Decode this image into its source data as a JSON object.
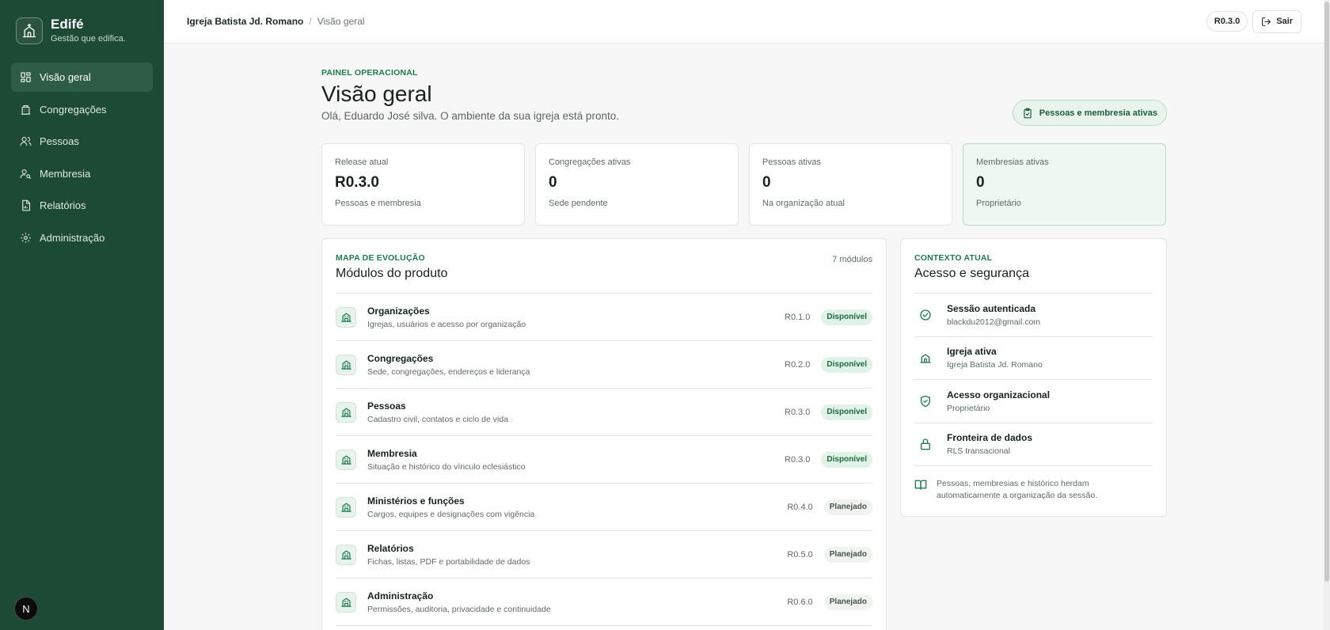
{
  "brand": {
    "name": "Edifé",
    "tagline": "Gestão que edifica."
  },
  "sidebar": {
    "items": [
      {
        "label": "Visão geral",
        "icon": "dashboard-icon",
        "active": true
      },
      {
        "label": "Congregações",
        "icon": "building-icon"
      },
      {
        "label": "Pessoas",
        "icon": "users-icon"
      },
      {
        "label": "Membresia",
        "icon": "user-key-icon"
      },
      {
        "label": "Relatórios",
        "icon": "report-icon"
      },
      {
        "label": "Administração",
        "icon": "gear-icon"
      }
    ],
    "dev_badge": "N"
  },
  "topbar": {
    "org": "Igreja Batista Jd. Romano",
    "separator": "/",
    "page": "Visão geral",
    "version": "R0.3.0",
    "logout": "Sair"
  },
  "header": {
    "eyebrow": "PAINEL OPERACIONAL",
    "title": "Visão geral",
    "greeting": "Olá, Eduardo José silva. O ambiente da sua igreja está pronto.",
    "chip": "Pessoas e membresia ativas"
  },
  "stats": [
    {
      "label": "Release atual",
      "value": "R0.3.0",
      "sub": "Pessoas e membresia"
    },
    {
      "label": "Congregações ativas",
      "value": "0",
      "sub": "Sede pendente"
    },
    {
      "label": "Pessoas ativas",
      "value": "0",
      "sub": "Na organização atual"
    },
    {
      "label": "Membresias ativas",
      "value": "0",
      "sub": "Proprietário"
    }
  ],
  "modules": {
    "eyebrow": "MAPA DE EVOLUÇÃO",
    "title": "Módulos do produto",
    "count": "7 módulos",
    "rows": [
      {
        "name": "Organizações",
        "desc": "Igrejas, usuários e acesso por organização",
        "release": "R0.1.0",
        "status": "Disponível"
      },
      {
        "name": "Congregações",
        "desc": "Sede, congregações, endereços e liderança",
        "release": "R0.2.0",
        "status": "Disponível"
      },
      {
        "name": "Pessoas",
        "desc": "Cadastro civil, contatos e ciclo de vida",
        "release": "R0.3.0",
        "status": "Disponível"
      },
      {
        "name": "Membresia",
        "desc": "Situação e histórico do vínculo eclesiástico",
        "release": "R0.3.0",
        "status": "Disponível"
      },
      {
        "name": "Ministérios e funções",
        "desc": "Cargos, equipes e designações com vigência",
        "release": "R0.4.0",
        "status": "Planejado"
      },
      {
        "name": "Relatórios",
        "desc": "Fichas, listas, PDF e portabilidade de dados",
        "release": "R0.5.0",
        "status": "Planejado"
      },
      {
        "name": "Administração",
        "desc": "Permissões, auditoria, privacidade e continuidade",
        "release": "R0.6.0",
        "status": "Planejado"
      }
    ]
  },
  "context": {
    "eyebrow": "CONTEXTO ATUAL",
    "title": "Acesso e segurança",
    "rows": [
      {
        "name": "Sessão autenticada",
        "value": "blackdu2012@gmail.com",
        "icon": "check-circle-icon"
      },
      {
        "name": "Igreja ativa",
        "value": "Igreja Batista Jd. Romano",
        "icon": "church-icon"
      },
      {
        "name": "Acesso organizacional",
        "value": "Proprietário",
        "icon": "shield-check-icon"
      },
      {
        "name": "Fronteira de dados",
        "value": "RLS transacional",
        "icon": "lock-icon"
      }
    ],
    "note": "Pessoas, membresias e histórico herdam automaticamente a organização da sessão."
  },
  "colors": {
    "sidebar": "#1d4a35",
    "accent": "#207a4f",
    "badge_available": "#e1f2e7"
  }
}
